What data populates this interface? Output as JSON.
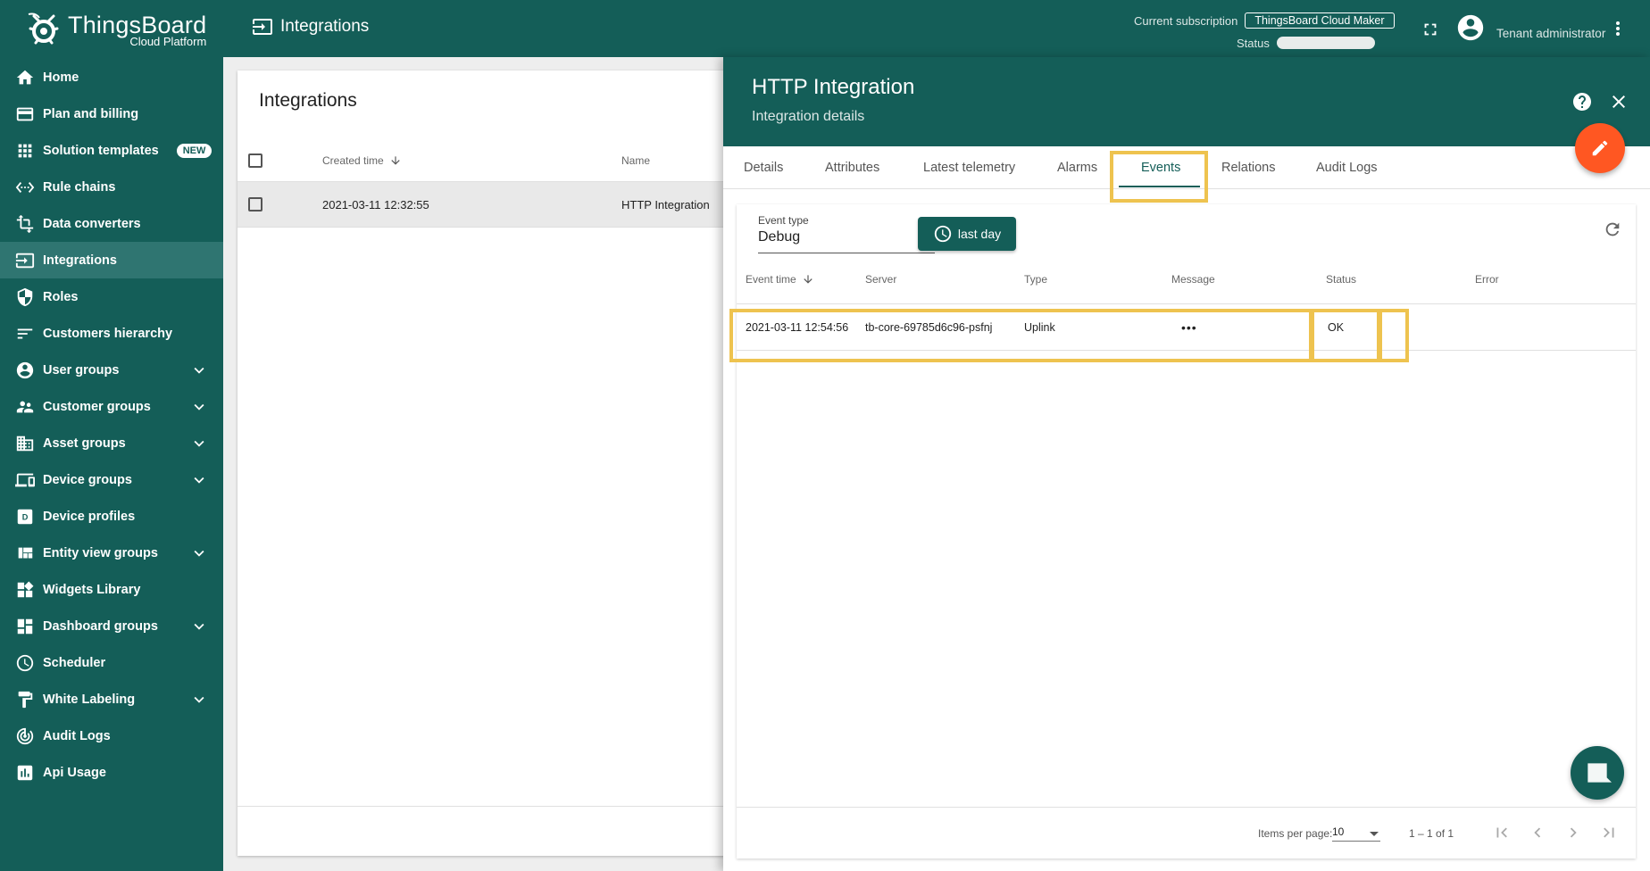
{
  "app": {
    "logo_title": "ThingsBoard",
    "logo_subtitle": "Cloud Platform",
    "page_heading": "Integrations",
    "brand_color": "#145e58",
    "accent_color": "#ff5722",
    "highlight_color": "#eec34f"
  },
  "topbar": {
    "subscription_label": "Current subscription",
    "subscription_value": "ThingsBoard Cloud Maker",
    "status_label": "Status",
    "user_role": "Tenant administrator"
  },
  "sidebar": {
    "items": [
      {
        "label": "Home",
        "icon": "home-icon"
      },
      {
        "label": "Plan and billing",
        "icon": "billing-icon"
      },
      {
        "label": "Solution templates",
        "icon": "apps-icon",
        "badge": "NEW"
      },
      {
        "label": "Rule chains",
        "icon": "settings-ethernet-icon"
      },
      {
        "label": "Data converters",
        "icon": "transform-icon"
      },
      {
        "label": "Integrations",
        "icon": "input-icon",
        "active": true
      },
      {
        "label": "Roles",
        "icon": "security-icon"
      },
      {
        "label": "Customers hierarchy",
        "icon": "sort-icon"
      },
      {
        "label": "User groups",
        "icon": "account-circle-icon",
        "expandable": true
      },
      {
        "label": "Customer groups",
        "icon": "supervisor-icon",
        "expandable": true
      },
      {
        "label": "Asset groups",
        "icon": "domain-icon",
        "expandable": true
      },
      {
        "label": "Device groups",
        "icon": "devices-icon",
        "expandable": true
      },
      {
        "label": "Device profiles",
        "icon": "device-profile-icon"
      },
      {
        "label": "Entity view groups",
        "icon": "view-quilt-icon",
        "expandable": true
      },
      {
        "label": "Widgets Library",
        "icon": "widgets-icon"
      },
      {
        "label": "Dashboard groups",
        "icon": "dashboards-icon",
        "expandable": true
      },
      {
        "label": "Scheduler",
        "icon": "schedule-icon"
      },
      {
        "label": "White Labeling",
        "icon": "format-paint-icon",
        "expandable": true
      },
      {
        "label": "Audit Logs",
        "icon": "track-changes-icon"
      },
      {
        "label": "Api Usage",
        "icon": "insert-chart-icon"
      }
    ]
  },
  "list": {
    "title": "Integrations",
    "columns": [
      "Created time",
      "Name"
    ],
    "rows": [
      {
        "created": "2021-03-11 12:32:55",
        "name": "HTTP Integration"
      }
    ]
  },
  "panel": {
    "title": "HTTP Integration",
    "subtitle": "Integration details",
    "tabs": [
      "Details",
      "Attributes",
      "Latest telemetry",
      "Alarms",
      "Events",
      "Relations",
      "Audit Logs"
    ],
    "active_tab": "Events"
  },
  "events": {
    "event_type_label": "Event type",
    "event_type_value": "Debug",
    "time_button": "last day",
    "columns": [
      "Event time",
      "Server",
      "Type",
      "Message",
      "Status",
      "Error"
    ],
    "rows": [
      {
        "time": "2021-03-11 12:54:56",
        "server": "tb-core-69785d6c96-psfnj",
        "type": "Uplink",
        "message": "•••",
        "status": "OK",
        "error": ""
      }
    ],
    "items_per_page_label": "Items per page:",
    "items_per_page_value": "10",
    "range_label": "1 – 1 of 1"
  }
}
